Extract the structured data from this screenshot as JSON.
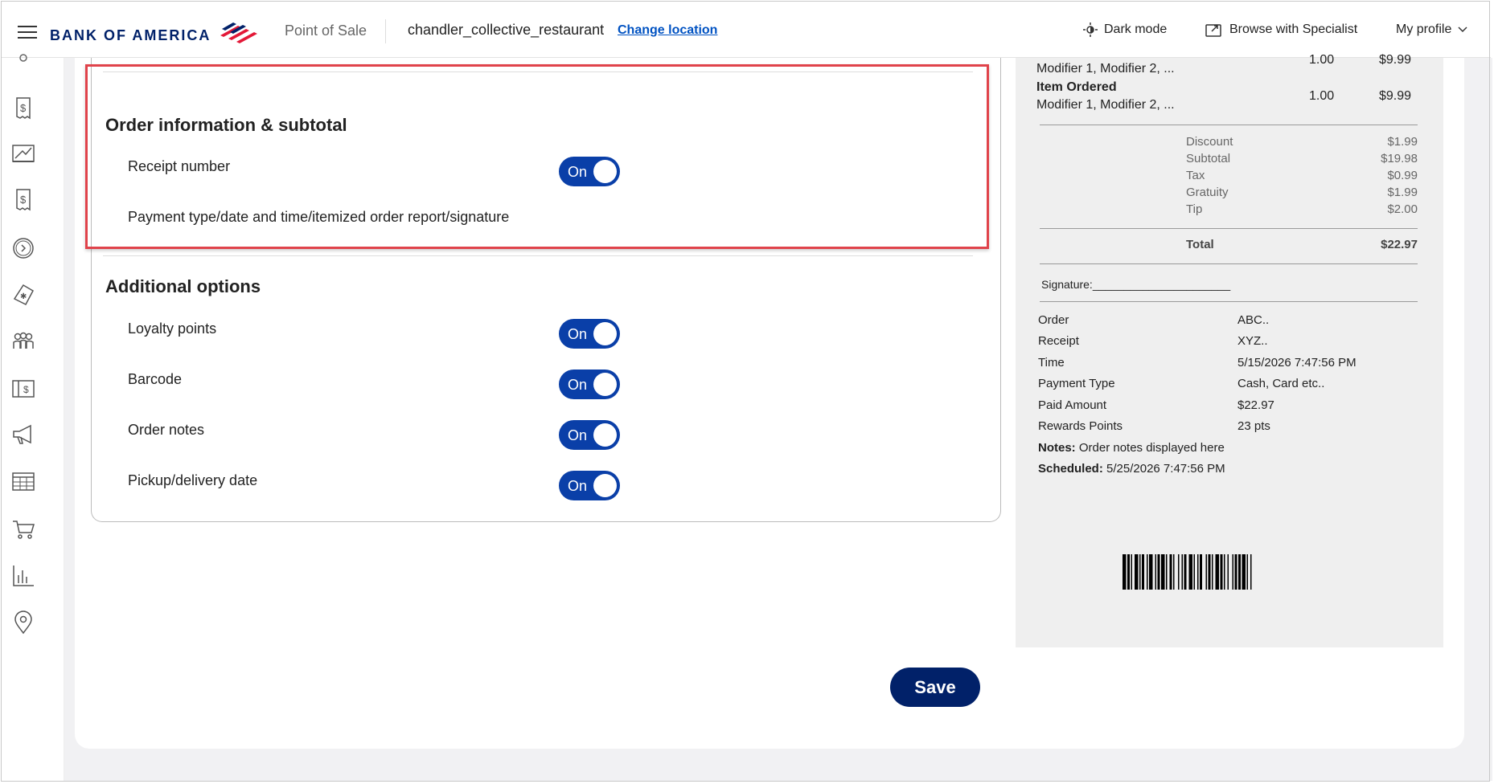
{
  "header": {
    "brand": "BANK OF AMERICA",
    "product": "Point of Sale",
    "location": "chandler_collective_restaurant",
    "change_location": "Change location",
    "dark_mode": "Dark mode",
    "browse_specialist": "Browse with Specialist",
    "my_profile": "My profile"
  },
  "sidebar": {
    "icons": [
      "gear-icon",
      "receipt-dollar-icon",
      "chart-icon",
      "invoice-dollar-icon",
      "clock-icon",
      "tag-icon",
      "customers-icon",
      "gift-card-icon",
      "megaphone-icon",
      "calendar-icon",
      "cart-icon",
      "bar-chart-icon",
      "location-pin-icon"
    ]
  },
  "settings": {
    "order_info": {
      "title": "Order information & subtotal",
      "receipt_number": "Receipt number",
      "receipt_number_toggle": "On",
      "payment_info": "Payment type/date and time/itemized order report/signature"
    },
    "additional": {
      "title": "Additional options",
      "items": [
        {
          "label": "Loyalty points",
          "toggle": "On"
        },
        {
          "label": "Barcode",
          "toggle": "On"
        },
        {
          "label": "Order notes",
          "toggle": "On"
        },
        {
          "label": "Pickup/delivery date",
          "toggle": "On"
        }
      ]
    }
  },
  "receipt": {
    "partial_row": {
      "modifiers": "Modifier 1, Modifier 2, ...",
      "qty": "1.00",
      "price": "$9.99"
    },
    "item_row": {
      "name": "Item Ordered",
      "modifiers": "Modifier 1, Modifier 2, ...",
      "qty": "1.00",
      "price": "$9.99"
    },
    "summary": [
      {
        "label": "Discount",
        "value": "$1.99"
      },
      {
        "label": "Subtotal",
        "value": "$19.98"
      },
      {
        "label": "Tax",
        "value": "$0.99"
      },
      {
        "label": "Gratuity",
        "value": "$1.99"
      },
      {
        "label": "Tip",
        "value": "$2.00"
      }
    ],
    "total": {
      "label": "Total",
      "value": "$22.97"
    },
    "signature": "Signature:______________________",
    "details": [
      {
        "label": "Order",
        "value": "ABC.."
      },
      {
        "label": "Receipt",
        "value": "XYZ.."
      },
      {
        "label": "Time",
        "value": "5/15/2026 7:47:56 PM"
      },
      {
        "label": "Payment Type",
        "value": "Cash, Card etc.."
      },
      {
        "label": "Paid Amount",
        "value": "$22.97"
      },
      {
        "label": "Rewards Points",
        "value": "23 pts"
      }
    ],
    "notes_label": "Notes:",
    "notes_value": "Order notes displayed here",
    "scheduled_label": "Scheduled:",
    "scheduled_value": "5/25/2026 7:47:56 PM"
  },
  "actions": {
    "save": "Save"
  }
}
